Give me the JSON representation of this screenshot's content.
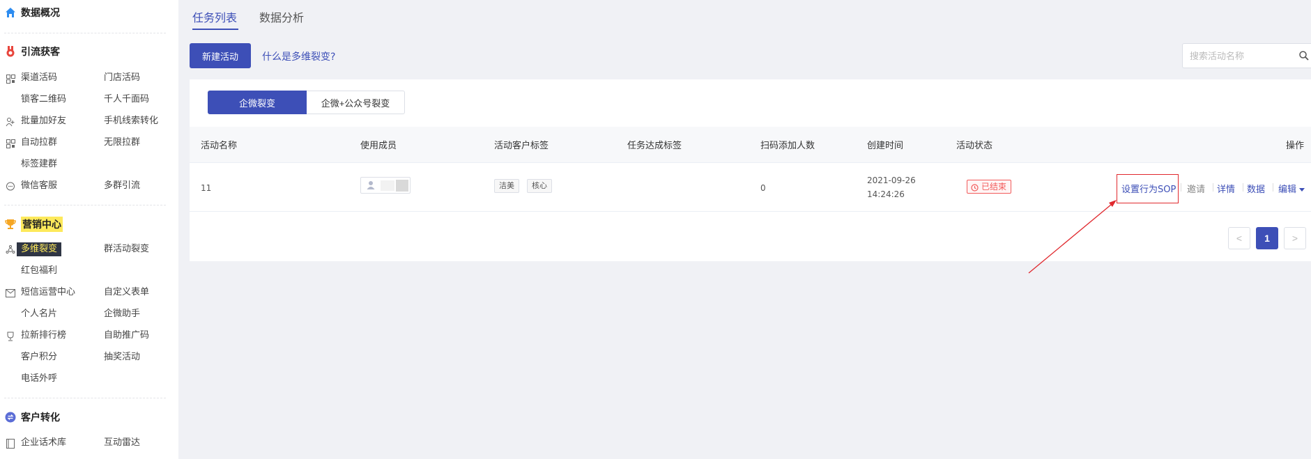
{
  "sidebar": {
    "sections": [
      {
        "title": "数据概况",
        "icon": "home-icon",
        "color": "#2d8cf0"
      },
      {
        "title": "引流获客",
        "icon": "medal-icon",
        "color": "#e8453c"
      },
      {
        "title": "营销中心",
        "icon": "trophy-icon",
        "color": "#f5a623"
      },
      {
        "title": "客户转化",
        "icon": "exchange-icon",
        "color": "#5b6dd6"
      }
    ],
    "items": {
      "qudao_huoma": "渠道活码",
      "mendian_huoma": "门店活码",
      "suoke_erweima": "锁客二维码",
      "qianren_qianmian": "千人千面码",
      "piliang_jiahaoyou": "批量加好友",
      "shouji_xiansuo": "手机线索转化",
      "zidong_laqun": "自动拉群",
      "wuxian_laqun": "无限拉群",
      "biaoqian_jianqun": "标签建群",
      "weixin_kefu": "微信客服",
      "duoqun_yinliu": "多群引流",
      "duowei_liebian": "多维裂变",
      "qunhuodong_liebian": "群活动裂变",
      "hongbao_fuli": "红包福利",
      "duanxin_yunying": "短信运营中心",
      "zidingyi_biaodan": "自定义表单",
      "geren_mingpian": "个人名片",
      "qiwei_zhushou": "企微助手",
      "laxin_paihangbang": "拉新排行榜",
      "zizhu_tuiguangma": "自助推广码",
      "kehu_jifen": "客户积分",
      "choujiang_huodong": "抽奖活动",
      "dianhua_waihu": "电话外呼",
      "qiye_huashuku": "企业话术库",
      "hudong_leida": "互动雷达"
    }
  },
  "tabs": [
    {
      "label": "任务列表",
      "active": true
    },
    {
      "label": "数据分析",
      "active": false
    }
  ],
  "toolbar": {
    "new_label": "新建活动",
    "help_link": "什么是多维裂变?",
    "search_placeholder": "搜索活动名称"
  },
  "segment": {
    "on": "企微裂变",
    "off": "企微+公众号裂变"
  },
  "table": {
    "headers": [
      "活动名称",
      "使用成员",
      "活动客户标签",
      "任务达成标签",
      "扫码添加人数",
      "创建时间",
      "活动状态",
      "操作"
    ],
    "row": {
      "name": "11",
      "tags": [
        "洁美",
        "核心"
      ],
      "scan_count": "0",
      "created_date": "2021-09-26",
      "created_time": "14:24:26",
      "status": "已结束",
      "actions": {
        "sop": "设置行为SOP",
        "invite": "邀请",
        "detail": "详情",
        "data": "数据",
        "edit": "编辑"
      }
    }
  },
  "pager": {
    "prev": "<",
    "current": "1",
    "next": ">"
  },
  "colors": {
    "accent": "#3d4fb7",
    "danger": "#f25b5b",
    "highlight": "#e0282d"
  }
}
